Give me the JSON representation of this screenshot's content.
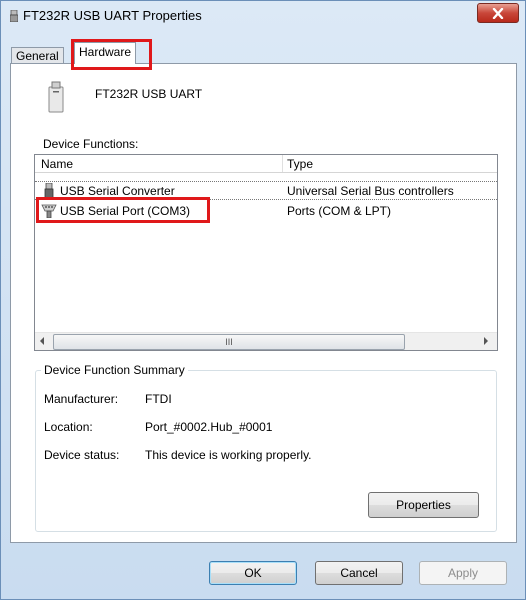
{
  "window": {
    "title": "FT232R USB UART Properties"
  },
  "tabs": {
    "general": "General",
    "hardware": "Hardware"
  },
  "device": {
    "name": "FT232R USB UART"
  },
  "functions": {
    "label": "Device Functions:",
    "columns": {
      "name": "Name",
      "type": "Type"
    },
    "rows": [
      {
        "name": "USB Serial Converter",
        "type": "Universal Serial Bus controllers",
        "icon": "usb-connector-icon"
      },
      {
        "name": "USB Serial Port (COM3)",
        "type": "Ports (COM & LPT)",
        "icon": "serial-port-icon"
      }
    ],
    "scroll_thumb": "III"
  },
  "summary": {
    "legend": "Device Function Summary",
    "manufacturer_label": "Manufacturer:",
    "manufacturer_value": "FTDI",
    "location_label": "Location:",
    "location_value": "Port_#0002.Hub_#0001",
    "status_label": "Device status:",
    "status_value": "This device is working properly.",
    "properties_button": "Properties"
  },
  "buttons": {
    "ok": "OK",
    "cancel": "Cancel",
    "apply": "Apply"
  },
  "colors": {
    "highlight_box": "#e0181a",
    "close_button": "#c9473a"
  }
}
